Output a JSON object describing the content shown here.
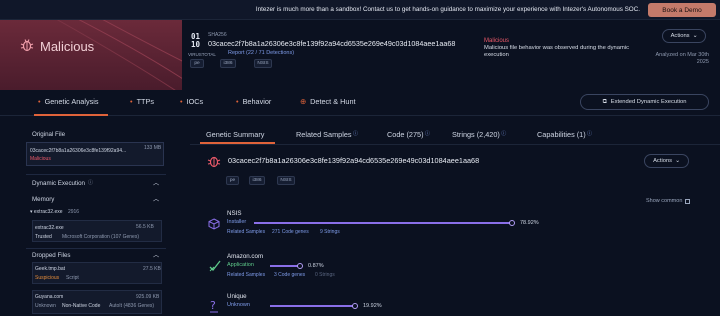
{
  "banner": {
    "text": "Intezer is much more than a sandbox! Contact us to get hands-on guidance to maximize your experience with Intezer's Autonomous SOC.",
    "book_label": "Book a Demo"
  },
  "header": {
    "verdict_badge": "Malicious",
    "sha_title": "SHA256",
    "sha_value": "03cacec2f7b8a1a26306e3c8fe139f92a94cd6535e269e49c03d1084aee1aa68",
    "virustotal_label": "VIRUSTOTAL",
    "report_link": "Report (22 / 71 Detections)",
    "tags": [
      "pe",
      "i386",
      "NSIS"
    ],
    "verdict_title": "Malicious",
    "verdict_desc": "Malicious file behavior was observed during the dynamic execution",
    "actions_label": "Actions",
    "analyzed_text": "Analyzed on Mar 30th 2025"
  },
  "nav": {
    "items": [
      "Genetic Analysis",
      "TTPs",
      "IOCs",
      "Behavior",
      "Detect & Hunt"
    ],
    "ext_button": "Extended Dynamic Execution"
  },
  "left": {
    "original_file_title": "Original File",
    "original_file": {
      "name": "03cacec2f7b8a1a26306e3c8fe139f92a94...",
      "size": "133 MB",
      "verdict": "Malicious"
    },
    "dynamic_title": "Dynamic Execution",
    "memory_title": "Memory",
    "memory_process": "extrac32.exe",
    "memory_pid": "2916",
    "memory_entry": {
      "name": "extrac32.exe",
      "size": "56.5 KB",
      "verdict": "Trusted",
      "vendor": "Microsoft Corporation (107 Genes)"
    },
    "dropped_title": "Dropped Files",
    "dropped": [
      {
        "name": "Geek.tmp.bat",
        "size": "27.5 KB",
        "verdict": "Suspicious",
        "type": "Script"
      },
      {
        "name": "Guyana.com",
        "size": "925.09 KB",
        "verdict": "Unknown",
        "type": "Non-Native Code",
        "vendor": "AutoIt (4836 Genes)"
      }
    ]
  },
  "main": {
    "tabs": [
      "Genetic Summary",
      "Related Samples",
      "Code (275)",
      "Strings (2,420)",
      "Capabilities (1)"
    ],
    "gene_sha": "03cacec2f7b8a1a26306e3c8fe139f92a94cd6535e269e49c03d1084aee1aa68",
    "actions_label": "Actions",
    "tags": [
      "pe",
      "i386",
      "NSIS"
    ],
    "show_common": "Show common",
    "families": [
      {
        "name": "NSIS",
        "type": "Installer",
        "percent": "78.92%",
        "fraction": 0.7892,
        "related": "Related Samples",
        "genes": "271 Code genes",
        "strings": "9 Strings",
        "type_color": "#7e9be8"
      },
      {
        "name": "Amazon.com",
        "type": "Application",
        "percent": "0.87%",
        "fraction": 0.0087,
        "related": "Related Samples",
        "genes": "3 Code genes",
        "strings": "0 Strings",
        "type_color": "#5ec98a"
      },
      {
        "name": "Unique",
        "type": "Unknown",
        "percent": "19.92%",
        "fraction": 0.1992,
        "related": "",
        "genes": "",
        "strings": "",
        "type_color": "#7e9be8"
      }
    ]
  },
  "colors": {
    "accent": "#e0633a",
    "malicious": "#ee5a6a",
    "bar": "#8a6fe8",
    "link": "#7e9be8"
  }
}
